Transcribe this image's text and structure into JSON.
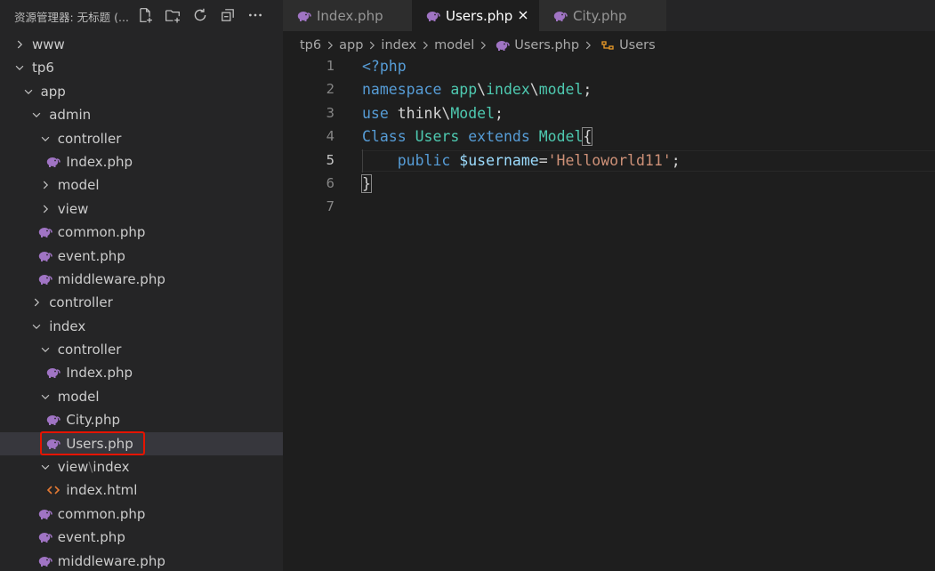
{
  "sidebar": {
    "title": "资源管理器: 无标题 (...",
    "actions": [
      {
        "name": "new-file-icon"
      },
      {
        "name": "new-folder-icon"
      },
      {
        "name": "refresh-icon"
      },
      {
        "name": "collapse-all-icon"
      },
      {
        "name": "more-icon"
      }
    ],
    "tree": [
      {
        "label": "www",
        "type": "folder",
        "expanded": false,
        "depth": 0
      },
      {
        "label": "tp6",
        "type": "folder",
        "expanded": true,
        "depth": 0
      },
      {
        "label": "app",
        "type": "folder",
        "expanded": true,
        "depth": 1
      },
      {
        "label": "admin",
        "type": "folder",
        "expanded": true,
        "depth": 2
      },
      {
        "label": "controller",
        "type": "folder",
        "expanded": true,
        "depth": 3
      },
      {
        "label": "Index.php",
        "type": "php",
        "depth": 4
      },
      {
        "label": "model",
        "type": "folder",
        "expanded": false,
        "depth": 3
      },
      {
        "label": "view",
        "type": "folder",
        "expanded": false,
        "depth": 3
      },
      {
        "label": "common.php",
        "type": "php",
        "depth": 3
      },
      {
        "label": "event.php",
        "type": "php",
        "depth": 3
      },
      {
        "label": "middleware.php",
        "type": "php",
        "depth": 3
      },
      {
        "label": "controller",
        "type": "folder",
        "expanded": false,
        "depth": 2
      },
      {
        "label": "index",
        "type": "folder",
        "expanded": true,
        "depth": 2
      },
      {
        "label": "controller",
        "type": "folder",
        "expanded": true,
        "depth": 3
      },
      {
        "label": "Index.php",
        "type": "php",
        "depth": 4
      },
      {
        "label": "model",
        "type": "folder",
        "expanded": true,
        "depth": 3
      },
      {
        "label": "City.php",
        "type": "php",
        "depth": 4
      },
      {
        "label": "Users.php",
        "type": "php",
        "depth": 4,
        "selected": true
      },
      {
        "label": "view",
        "label_suffix": "index",
        "type": "folder",
        "expanded": true,
        "depth": 3
      },
      {
        "label": "index.html",
        "type": "html",
        "depth": 4
      },
      {
        "label": "common.php",
        "type": "php",
        "depth": 3
      },
      {
        "label": "event.php",
        "type": "php",
        "depth": 3
      },
      {
        "label": "middleware.php",
        "type": "php",
        "depth": 3
      }
    ]
  },
  "tabs": [
    {
      "label": "Index.php",
      "active": false
    },
    {
      "label": "Users.php",
      "active": true
    },
    {
      "label": "City.php",
      "active": false
    }
  ],
  "breadcrumb": {
    "items": [
      "tp6",
      "app",
      "index",
      "model",
      "Users.php",
      "Users"
    ]
  },
  "editor": {
    "current_line": 5,
    "lines": [
      {
        "num": "1",
        "tokens": [
          {
            "t": "<?php",
            "c": "#569cd6"
          }
        ]
      },
      {
        "num": "2",
        "tokens": [
          {
            "t": "namespace",
            "c": "#569cd6"
          },
          {
            "t": " ",
            "c": "#d4d4d4"
          },
          {
            "t": "app",
            "c": "#4ec9b0"
          },
          {
            "t": "\\",
            "c": "#d4d4d4"
          },
          {
            "t": "index",
            "c": "#4ec9b0"
          },
          {
            "t": "\\",
            "c": "#d4d4d4"
          },
          {
            "t": "model",
            "c": "#4ec9b0"
          },
          {
            "t": ";",
            "c": "#d4d4d4"
          }
        ]
      },
      {
        "num": "3",
        "tokens": [
          {
            "t": "use",
            "c": "#569cd6"
          },
          {
            "t": " think",
            "c": "#d4d4d4"
          },
          {
            "t": "\\",
            "c": "#d4d4d4"
          },
          {
            "t": "Model",
            "c": "#4ec9b0"
          },
          {
            "t": ";",
            "c": "#d4d4d4"
          }
        ]
      },
      {
        "num": "4",
        "tokens": [
          {
            "t": "Class",
            "c": "#569cd6"
          },
          {
            "t": " ",
            "c": "#d4d4d4"
          },
          {
            "t": "Users",
            "c": "#4ec9b0"
          },
          {
            "t": " ",
            "c": "#d4d4d4"
          },
          {
            "t": "extends",
            "c": "#569cd6"
          },
          {
            "t": " ",
            "c": "#d4d4d4"
          },
          {
            "t": "Model",
            "c": "#4ec9b0"
          },
          {
            "t": "{",
            "c": "#d4d4d4",
            "hl": true
          }
        ]
      },
      {
        "num": "5",
        "tokens": [
          {
            "t": "    public",
            "c": "#569cd6"
          },
          {
            "t": " ",
            "c": "#d4d4d4"
          },
          {
            "t": "$username",
            "c": "#9cdcfe"
          },
          {
            "t": "=",
            "c": "#d4d4d4"
          },
          {
            "t": "'Helloworld11'",
            "c": "#ce9178"
          },
          {
            "t": ";",
            "c": "#d4d4d4"
          }
        ]
      },
      {
        "num": "6",
        "tokens": [
          {
            "t": "}",
            "c": "#d4d4d4",
            "hl": true
          }
        ]
      },
      {
        "num": "7",
        "tokens": []
      }
    ]
  },
  "colors": {
    "php_icon": "#a074c4",
    "html_icon": "#e37933",
    "selection_outline": "#e51400"
  }
}
